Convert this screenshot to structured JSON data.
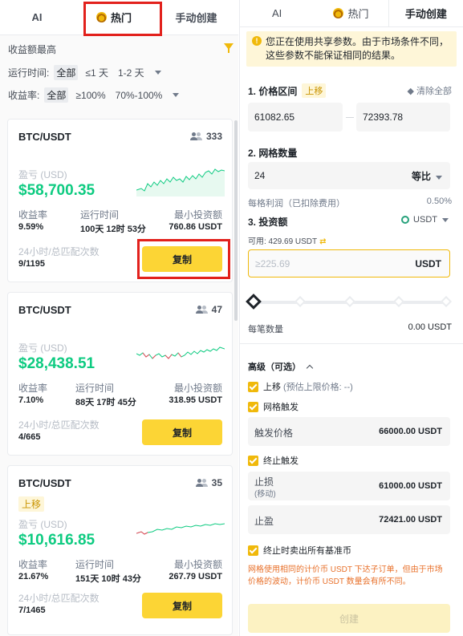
{
  "left_tabs": [
    {
      "label": "AI"
    },
    {
      "label": "热门"
    },
    {
      "label": "手动创建"
    }
  ],
  "right_tabs": [
    {
      "label": "AI"
    },
    {
      "label": "热门"
    },
    {
      "label": "手动创建"
    }
  ],
  "filters": {
    "sort": "收益额最高",
    "runtime_label": "运行时间:",
    "runtime_options": [
      "全部",
      "≤1 天",
      "1-2 天"
    ],
    "yield_label": "收益率:",
    "yield_options": [
      "全部",
      "≥100%",
      "70%-100%"
    ]
  },
  "cards": [
    {
      "pair": "BTC/USDT",
      "users": "333",
      "tag": "",
      "pl_label": "盈亏 (USD)",
      "pl_value": "$58,700.35",
      "yield_label": "收益率",
      "yield": "9.59%",
      "runtime_label": "运行时间",
      "runtime": "100天 12时 53分",
      "min_label": "最小投资额",
      "min_invest": "760.86 USDT",
      "match_label": "24小时/总匹配次数",
      "matches": "9/1195",
      "copy_label": "复制"
    },
    {
      "pair": "BTC/USDT",
      "users": "47",
      "tag": "",
      "pl_label": "盈亏 (USD)",
      "pl_value": "$28,438.51",
      "yield_label": "收益率",
      "yield": "7.10%",
      "runtime_label": "运行时间",
      "runtime": "88天 17时 45分",
      "min_label": "最小投资额",
      "min_invest": "318.95 USDT",
      "match_label": "24小时/总匹配次数",
      "matches": "4/665",
      "copy_label": "复制"
    },
    {
      "pair": "BTC/USDT",
      "users": "35",
      "tag": "上移",
      "pl_label": "盈亏 (USD)",
      "pl_value": "$10,616.85",
      "yield_label": "收益率",
      "yield": "21.67%",
      "runtime_label": "运行时间",
      "runtime": "151天 10时 43分",
      "min_label": "最小投资额",
      "min_invest": "267.79 USDT",
      "match_label": "24小时/总匹配次数",
      "matches": "7/1465",
      "copy_label": "复制"
    }
  ],
  "right": {
    "notice": "您正在使用共享参数。由于市场条件不同，这些参数不能保证相同的结果。",
    "price_range_title": "1. 价格区间",
    "price_range_badge": "上移",
    "clear_all": "清除全部",
    "price_low": "61082.65",
    "price_high": "72393.78",
    "grid_count_title": "2. 网格数量",
    "grid_count": "24",
    "grid_mode": "等比",
    "profit_per_grid_label": "每格利润（已扣除费用）",
    "profit_per_grid": "0.50%",
    "invest_title": "3. 投资额",
    "invest_currency": "USDT",
    "available": "可用: 429.69 USDT",
    "invest_placeholder": "≥225.69",
    "invest_suffix": "USDT",
    "per_order_label": "每笔数量",
    "per_order": "0.00 USDT",
    "advanced_title": "高级（可选）",
    "shift_up_label": "上移",
    "shift_up_hint": "(预估上限价格: --)",
    "grid_trigger_label": "网格触发",
    "trigger_price_label": "触发价格",
    "trigger_price": "66000.00 USDT",
    "stop_trigger_label": "终止触发",
    "stop_loss_label": "止损",
    "stop_loss_sub": "(移动)",
    "stop_loss": "61000.00 USDT",
    "take_profit_label": "止盈",
    "take_profit": "72421.00 USDT",
    "sell_all_label": "终止时卖出所有基准币",
    "disclaimer": "网格使用相同的计价币 USDT 下达子订单，但由于市场价格的波动，计价币 USDT 数量会有所不同。",
    "create_label": "创建"
  },
  "colors": {
    "accent": "#fcd535",
    "profit": "#0ecb81",
    "loss": "#f6465d",
    "warning_text": "#e8702a",
    "highlight_box": "#e2211c"
  }
}
